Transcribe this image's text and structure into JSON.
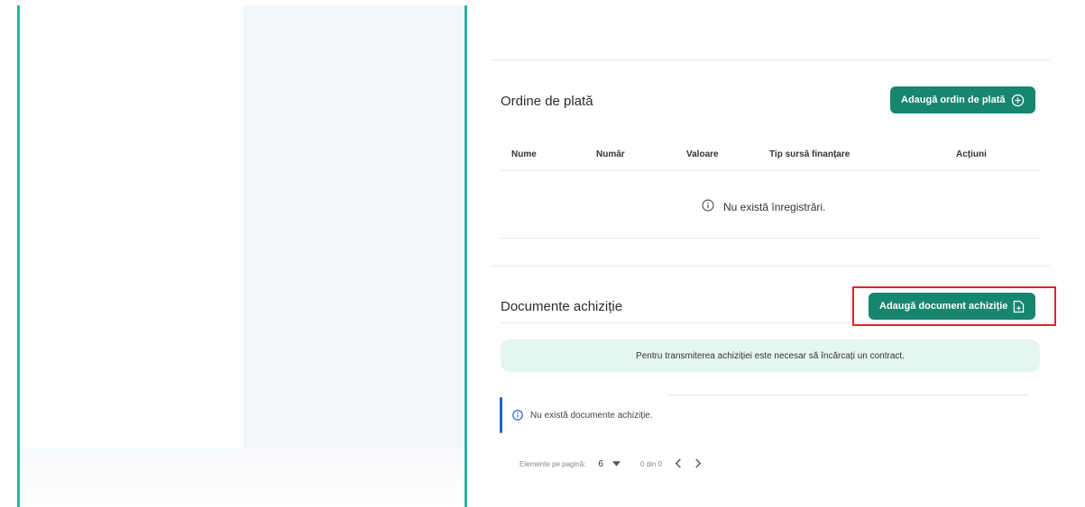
{
  "payment_orders": {
    "title": "Ordine de plată",
    "add_button_label": "Adaugă ordin de plată",
    "columns": [
      "Nume",
      "Număr",
      "Valoare",
      "Tip sursă finanțare",
      "Acțiuni"
    ],
    "empty_message": "Nu există înregistrări."
  },
  "procurement_docs": {
    "title": "Documente achiziție",
    "add_button_label": "Adaugă document achiziție",
    "info_banner": "Pentru transmiterea achiziției este necesar să încărcați un contract.",
    "empty_notice": "Nu există documente achiziție."
  },
  "pagination": {
    "items_per_page_label": "Elemente pe pagină:",
    "items_per_page_value": "6",
    "range_label": "0 din 0"
  },
  "colors": {
    "accent": "#2bb3a3",
    "primary_button": "#16866f",
    "highlight_border": "#e0232f",
    "info_banner_bg": "#e5f5f0",
    "notice_bar": "#2a5fd6"
  }
}
